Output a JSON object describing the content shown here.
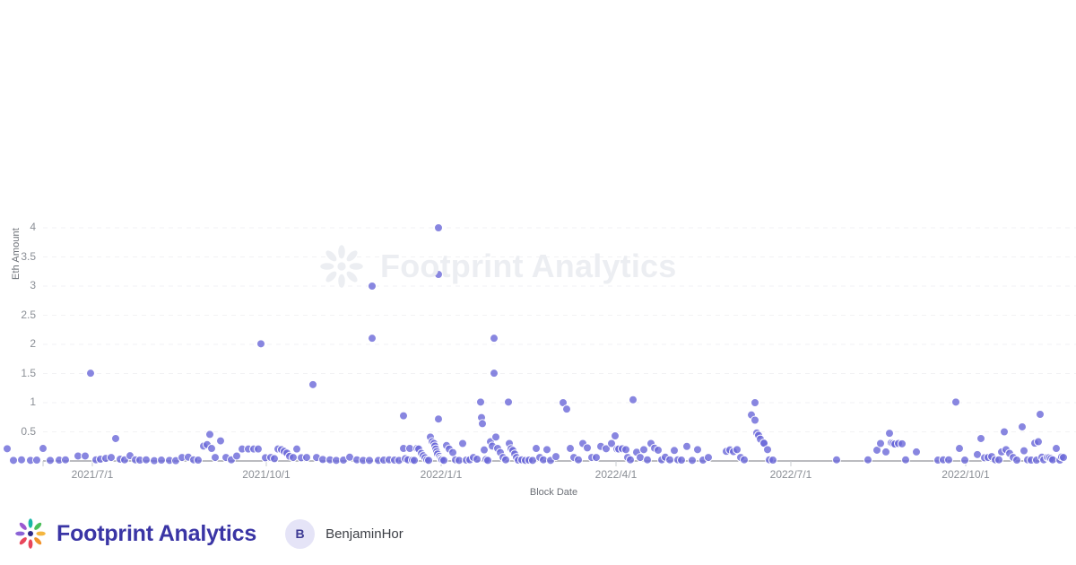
{
  "footer": {
    "brand_name": "Footprint Analytics",
    "logo_icon": "footprint-pinwheel-icon",
    "user": {
      "avatar_initial": "B",
      "name": "BenjaminHor"
    }
  },
  "watermark": {
    "text": "Footprint Analytics",
    "logo_icon": "footprint-pinwheel-icon"
  },
  "colors": {
    "point": "#6a68d8",
    "point_stroke": "#ffffff",
    "gridline": "#f2f2f4",
    "axis": "#8b8f96",
    "tick_text": "#8b8f96",
    "axis_title": "#6b6f76",
    "brand": "#3a35a5",
    "watermark": "#eceef2",
    "avatar_bg": "#e5e4f7",
    "background": "#ffffff"
  },
  "chart_data": {
    "type": "scatter",
    "title": "",
    "xlabel": "Block Date",
    "ylabel": "Eth Amount",
    "grid": true,
    "legend": "none",
    "series_name": "Eth Amount",
    "marker": {
      "shape": "circle",
      "size": 9,
      "color": "#6a68d8",
      "opacity": 0.8
    },
    "xlim": [
      "2021/6/10",
      "2022/11/5"
    ],
    "ylim": [
      0,
      4.35
    ],
    "yticks": [
      0.5,
      1,
      1.5,
      2,
      2.5,
      3,
      3.5,
      4
    ],
    "ytick_labels": [
      "0.5",
      "1",
      "1.5",
      "2",
      "2.5",
      "3",
      "3.5",
      "4"
    ],
    "xticks": [
      "2021/7/1",
      "2021/10/1",
      "2022/1/1",
      "2022/4/1",
      "2022/7/1",
      "2022/10/1"
    ],
    "xtick_labels": [
      "2021/7/1",
      "2021/10/1",
      "2022/1/1",
      "2022/4/1",
      "2022/7/1",
      "2022/10/1"
    ],
    "points": [
      [
        8,
        0.21
      ],
      [
        15,
        0.01
      ],
      [
        24,
        0.02
      ],
      [
        34,
        0.01
      ],
      [
        41,
        0.015
      ],
      [
        48,
        0.215
      ],
      [
        56,
        0.01
      ],
      [
        66,
        0.015
      ],
      [
        73,
        0.02
      ],
      [
        87,
        0.085
      ],
      [
        95,
        0.085
      ],
      [
        101,
        1.505
      ],
      [
        107,
        0.02
      ],
      [
        112,
        0.03
      ],
      [
        118,
        0.045
      ],
      [
        124,
        0.06
      ],
      [
        129,
        0.385
      ],
      [
        134,
        0.03
      ],
      [
        139,
        0.02
      ],
      [
        145,
        0.09
      ],
      [
        151,
        0.02
      ],
      [
        156,
        0.015
      ],
      [
        163,
        0.02
      ],
      [
        172,
        0.005
      ],
      [
        180,
        0.015
      ],
      [
        189,
        0.01
      ],
      [
        196,
        0.005
      ],
      [
        203,
        0.06
      ],
      [
        210,
        0.065
      ],
      [
        216,
        0.02
      ],
      [
        221,
        0.015
      ],
      [
        227,
        0.255
      ],
      [
        231,
        0.28
      ],
      [
        234,
        0.455
      ],
      [
        236,
        0.215
      ],
      [
        240,
        0.06
      ],
      [
        246,
        0.345
      ],
      [
        252,
        0.06
      ],
      [
        258,
        0.02
      ],
      [
        264,
        0.085
      ],
      [
        270,
        0.205
      ],
      [
        277,
        0.205
      ],
      [
        283,
        0.205
      ],
      [
        288,
        0.205
      ],
      [
        291,
        2.01
      ],
      [
        296,
        0.055
      ],
      [
        302,
        0.06
      ],
      [
        306,
        0.04
      ],
      [
        310,
        0.205
      ],
      [
        314,
        0.195
      ],
      [
        317,
        0.165
      ],
      [
        320,
        0.135
      ],
      [
        323,
        0.08
      ],
      [
        327,
        0.06
      ],
      [
        331,
        0.205
      ],
      [
        336,
        0.055
      ],
      [
        342,
        0.06
      ],
      [
        349,
        1.31
      ],
      [
        353,
        0.06
      ],
      [
        360,
        0.025
      ],
      [
        368,
        0.02
      ],
      [
        375,
        0.01
      ],
      [
        383,
        0.015
      ],
      [
        390,
        0.065
      ],
      [
        398,
        0.02
      ],
      [
        405,
        0.01
      ],
      [
        412,
        0.01
      ],
      [
        415,
        3.0
      ],
      [
        415,
        2.105
      ],
      [
        422,
        0.01
      ],
      [
        428,
        0.015
      ],
      [
        434,
        0.02
      ],
      [
        440,
        0.015
      ],
      [
        445,
        0.01
      ],
      [
        450,
        0.215
      ],
      [
        450,
        0.775
      ],
      [
        452,
        0.04
      ],
      [
        455,
        0.02
      ],
      [
        457,
        0.215
      ],
      [
        460,
        0.015
      ],
      [
        462,
        0.01
      ],
      [
        465,
        0.215
      ],
      [
        467,
        0.205
      ],
      [
        470,
        0.13
      ],
      [
        472,
        0.09
      ],
      [
        474,
        0.055
      ],
      [
        476,
        0.02
      ],
      [
        478,
        0.01
      ],
      [
        480,
        0.41
      ],
      [
        482,
        0.33
      ],
      [
        484,
        0.3
      ],
      [
        485,
        0.255
      ],
      [
        486,
        0.205
      ],
      [
        487,
        0.16
      ],
      [
        488,
        0.12
      ],
      [
        489,
        4.0
      ],
      [
        489,
        3.2
      ],
      [
        489,
        0.72
      ],
      [
        490,
        0.08
      ],
      [
        491,
        0.05
      ],
      [
        492,
        0.03
      ],
      [
        493,
        0.02
      ],
      [
        495,
        0.01
      ],
      [
        498,
        0.265
      ],
      [
        501,
        0.205
      ],
      [
        505,
        0.145
      ],
      [
        508,
        0.02
      ],
      [
        512,
        0.01
      ],
      [
        516,
        0.3
      ],
      [
        520,
        0.015
      ],
      [
        524,
        0.02
      ],
      [
        528,
        0.06
      ],
      [
        532,
        0.03
      ],
      [
        536,
        1.01
      ],
      [
        537,
        0.745
      ],
      [
        538,
        0.64
      ],
      [
        540,
        0.19
      ],
      [
        542,
        0.025
      ],
      [
        544,
        0.01
      ],
      [
        547,
        0.33
      ],
      [
        549,
        0.255
      ],
      [
        551,
        2.105
      ],
      [
        551,
        1.505
      ],
      [
        553,
        0.41
      ],
      [
        555,
        0.215
      ],
      [
        558,
        0.145
      ],
      [
        561,
        0.06
      ],
      [
        564,
        0.02
      ],
      [
        567,
        1.01
      ],
      [
        568,
        0.3
      ],
      [
        570,
        0.21
      ],
      [
        572,
        0.18
      ],
      [
        574,
        0.12
      ],
      [
        576,
        0.06
      ],
      [
        578,
        0.015
      ],
      [
        582,
        0.02
      ],
      [
        586,
        0.01
      ],
      [
        590,
        0.015
      ],
      [
        594,
        0.01
      ],
      [
        598,
        0.215
      ],
      [
        602,
        0.06
      ],
      [
        606,
        0.02
      ],
      [
        610,
        0.195
      ],
      [
        614,
        0.01
      ],
      [
        620,
        0.075
      ],
      [
        628,
        1.0
      ],
      [
        632,
        0.89
      ],
      [
        636,
        0.215
      ],
      [
        640,
        0.06
      ],
      [
        645,
        0.02
      ],
      [
        650,
        0.3
      ],
      [
        655,
        0.225
      ],
      [
        660,
        0.06
      ],
      [
        665,
        0.06
      ],
      [
        670,
        0.25
      ],
      [
        676,
        0.21
      ],
      [
        682,
        0.3
      ],
      [
        686,
        0.43
      ],
      [
        688,
        0.205
      ],
      [
        690,
        0.205
      ],
      [
        694,
        0.21
      ],
      [
        698,
        0.195
      ],
      [
        700,
        0.06
      ],
      [
        703,
        0.02
      ],
      [
        706,
        1.05
      ],
      [
        710,
        0.15
      ],
      [
        714,
        0.06
      ],
      [
        718,
        0.195
      ],
      [
        722,
        0.02
      ],
      [
        726,
        0.3
      ],
      [
        730,
        0.22
      ],
      [
        734,
        0.185
      ],
      [
        738,
        0.02
      ],
      [
        742,
        0.065
      ],
      [
        747,
        0.02
      ],
      [
        752,
        0.18
      ],
      [
        756,
        0.02
      ],
      [
        760,
        0.015
      ],
      [
        766,
        0.25
      ],
      [
        772,
        0.01
      ],
      [
        778,
        0.195
      ],
      [
        784,
        0.015
      ],
      [
        790,
        0.06
      ],
      [
        810,
        0.165
      ],
      [
        814,
        0.19
      ],
      [
        818,
        0.16
      ],
      [
        822,
        0.195
      ],
      [
        826,
        0.06
      ],
      [
        830,
        0.02
      ],
      [
        838,
        0.79
      ],
      [
        842,
        1.0
      ],
      [
        842,
        0.7
      ],
      [
        844,
        0.48
      ],
      [
        846,
        0.44
      ],
      [
        848,
        0.375
      ],
      [
        852,
        0.3
      ],
      [
        852,
        0.305
      ],
      [
        856,
        0.195
      ],
      [
        858,
        0.02
      ],
      [
        862,
        0.015
      ],
      [
        933,
        0.02
      ],
      [
        968,
        0.02
      ],
      [
        978,
        0.185
      ],
      [
        982,
        0.3
      ],
      [
        988,
        0.155
      ],
      [
        992,
        0.475
      ],
      [
        994,
        0.31
      ],
      [
        996,
        0.3
      ],
      [
        998,
        0.29
      ],
      [
        1002,
        0.3
      ],
      [
        1006,
        0.295
      ],
      [
        1010,
        0.02
      ],
      [
        1022,
        0.155
      ],
      [
        1046,
        0.015
      ],
      [
        1052,
        0.02
      ],
      [
        1058,
        0.02
      ],
      [
        1066,
        1.01
      ],
      [
        1070,
        0.215
      ],
      [
        1076,
        0.015
      ],
      [
        1090,
        0.11
      ],
      [
        1094,
        0.385
      ],
      [
        1098,
        0.055
      ],
      [
        1102,
        0.06
      ],
      [
        1106,
        0.075
      ],
      [
        1110,
        0.02
      ],
      [
        1114,
        0.02
      ],
      [
        1117,
        0.155
      ],
      [
        1120,
        0.5
      ],
      [
        1122,
        0.195
      ],
      [
        1126,
        0.13
      ],
      [
        1130,
        0.06
      ],
      [
        1134,
        0.015
      ],
      [
        1140,
        0.585
      ],
      [
        1142,
        0.175
      ],
      [
        1146,
        0.02
      ],
      [
        1150,
        0.015
      ],
      [
        1154,
        0.305
      ],
      [
        1156,
        0.015
      ],
      [
        1158,
        0.33
      ],
      [
        1160,
        0.8
      ],
      [
        1162,
        0.065
      ],
      [
        1164,
        0.02
      ],
      [
        1168,
        0.06
      ],
      [
        1170,
        0.055
      ],
      [
        1172,
        0.04
      ],
      [
        1174,
        0.02
      ],
      [
        1178,
        0.215
      ],
      [
        1182,
        0.015
      ],
      [
        1184,
        0.07
      ],
      [
        1186,
        0.06
      ]
    ]
  }
}
